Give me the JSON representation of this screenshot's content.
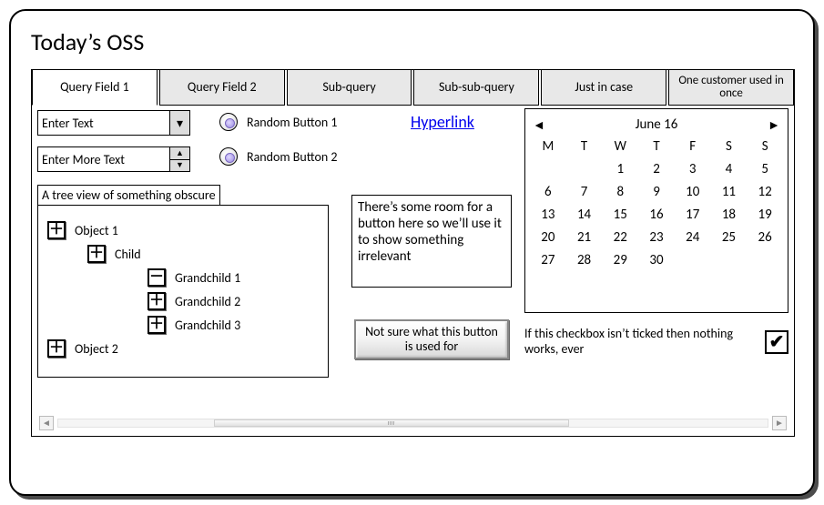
{
  "title": "Today’s OSS",
  "tabs": [
    {
      "label": "Query Field 1"
    },
    {
      "label": "Query Field 2"
    },
    {
      "label": "Sub-query"
    },
    {
      "label": "Sub-sub-query"
    },
    {
      "label": "Just in case"
    },
    {
      "label": "One customer used in once"
    }
  ],
  "combo_placeholder": "Enter Text",
  "spinner_placeholder": "Enter More Text",
  "radios": {
    "r1": "Random Button 1",
    "r2": "Random Button 2"
  },
  "link_text": "Hyperlink",
  "tree": {
    "heading": "A tree view of something obscure",
    "nodes": {
      "obj1": "Object 1",
      "child": "Child",
      "gc1": "Grandchild 1",
      "gc2": "Grandchild 2",
      "gc3": "Grandchild 3",
      "obj2": "Object 2"
    }
  },
  "info_text": "There’s some room for a button  here so we’ll use it to show something irrelevant",
  "mystery_button": "Not sure what this button is used for",
  "calendar": {
    "title": "June 16",
    "weekdays": [
      "M",
      "T",
      "W",
      "T",
      "F",
      "S",
      "S"
    ],
    "leading_blanks": 2,
    "days": [
      1,
      2,
      3,
      4,
      5,
      6,
      7,
      8,
      9,
      10,
      11,
      12,
      13,
      14,
      15,
      16,
      17,
      18,
      19,
      20,
      21,
      22,
      23,
      24,
      25,
      26,
      27,
      28,
      29,
      30
    ]
  },
  "checkbox": {
    "label": "If this checkbox isn’t ticked then nothing works, ever",
    "checked": true
  },
  "expanders": {
    "plus": "＋",
    "minus": "－"
  },
  "arrows": {
    "left": "◄",
    "right": "►",
    "down": "▼",
    "up": "▲"
  },
  "check_glyph": "✔"
}
